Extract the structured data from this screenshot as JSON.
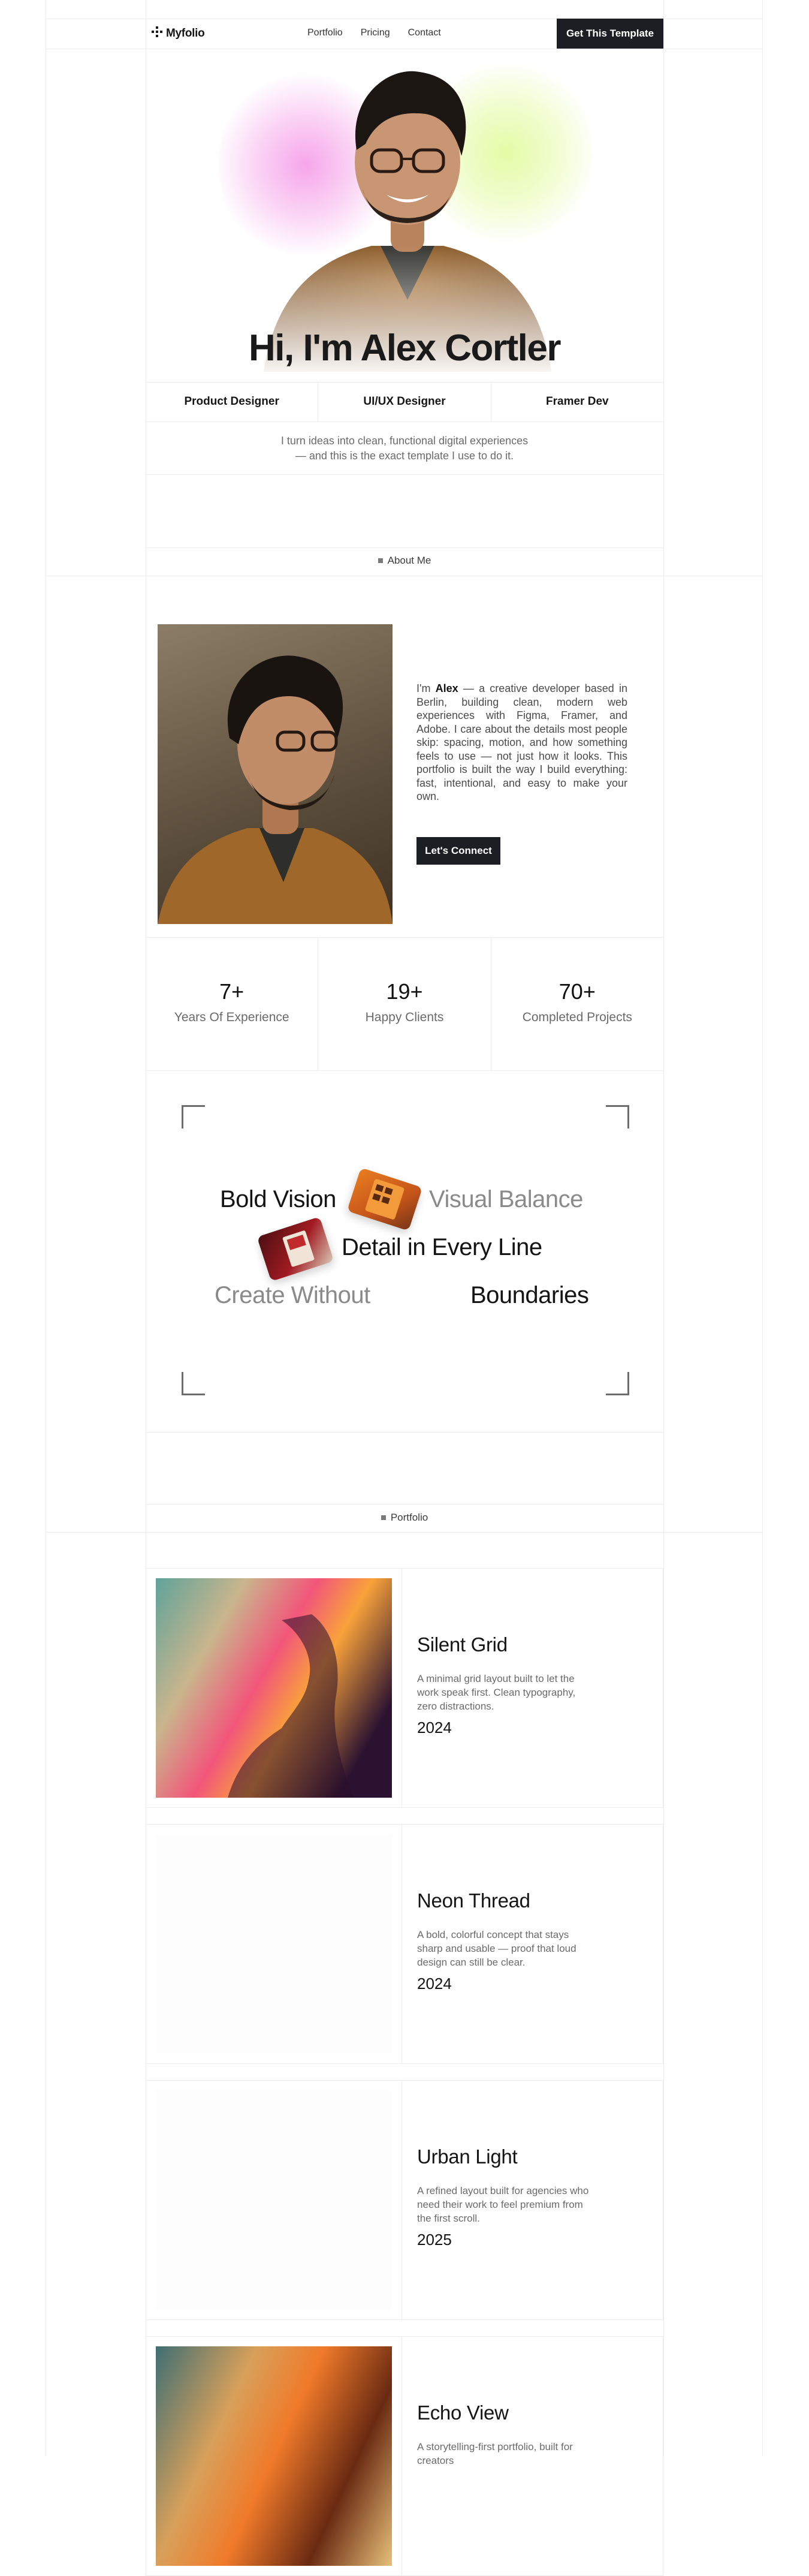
{
  "nav": {
    "logo_text": "Myfolio",
    "links": [
      "Portfolio",
      "Pricing",
      "Contact"
    ],
    "cta_label": "Get This Template"
  },
  "hero": {
    "title": "Hi, I'm Alex Cortler",
    "roles": [
      "Product Designer",
      "UI/UX Designer",
      "Framer Dev"
    ],
    "subtitle_line1": "I turn ideas into clean, functional digital experiences",
    "subtitle_line2": "— and this is the exact template I use to do it."
  },
  "about": {
    "label": "About Me",
    "intro": "I'm ",
    "name": "Alex",
    "body": " — a creative developer based in Berlin, building clean, modern web experiences with Figma, Framer, and Adobe. I care about the details most people skip: spacing, motion, and how something feels to use — not just how it looks. This portfolio is built the way I build everything: fast, intentional, and easy to make your own.",
    "button_label": "Let's Connect"
  },
  "stats": [
    {
      "value": "7+",
      "label": "Years Of Experience"
    },
    {
      "value": "19+",
      "label": "Happy Clients"
    },
    {
      "value": "70+",
      "label": "Completed Projects"
    }
  ],
  "showcase": {
    "line1_left": "Bold Vision",
    "line1_right": "Visual Balance",
    "line2": "Detail in Every Line",
    "line3_left": "Create Without",
    "line3_right": "Boundaries"
  },
  "portfolio": {
    "label": "Portfolio",
    "projects": [
      {
        "title": "Silent Grid",
        "description": "A minimal grid layout built to let the work speak first. Clean typography, zero distractions.",
        "year": "2024"
      },
      {
        "title": "Neon Thread",
        "description": "A bold, colorful concept that stays sharp and usable — proof that loud design can still be clear.",
        "year": "2024"
      },
      {
        "title": "Urban Light",
        "description": "A refined layout built for agencies who need their work to feel premium from the first scroll.",
        "year": "2025"
      },
      {
        "title": "Echo View",
        "description": "A storytelling-first portfolio, built for creators",
        "year": ""
      }
    ]
  },
  "colors": {
    "accent_dark": "#1d1d24",
    "glow_pink": "#f6a6ea",
    "glow_green": "#e4fba6"
  }
}
